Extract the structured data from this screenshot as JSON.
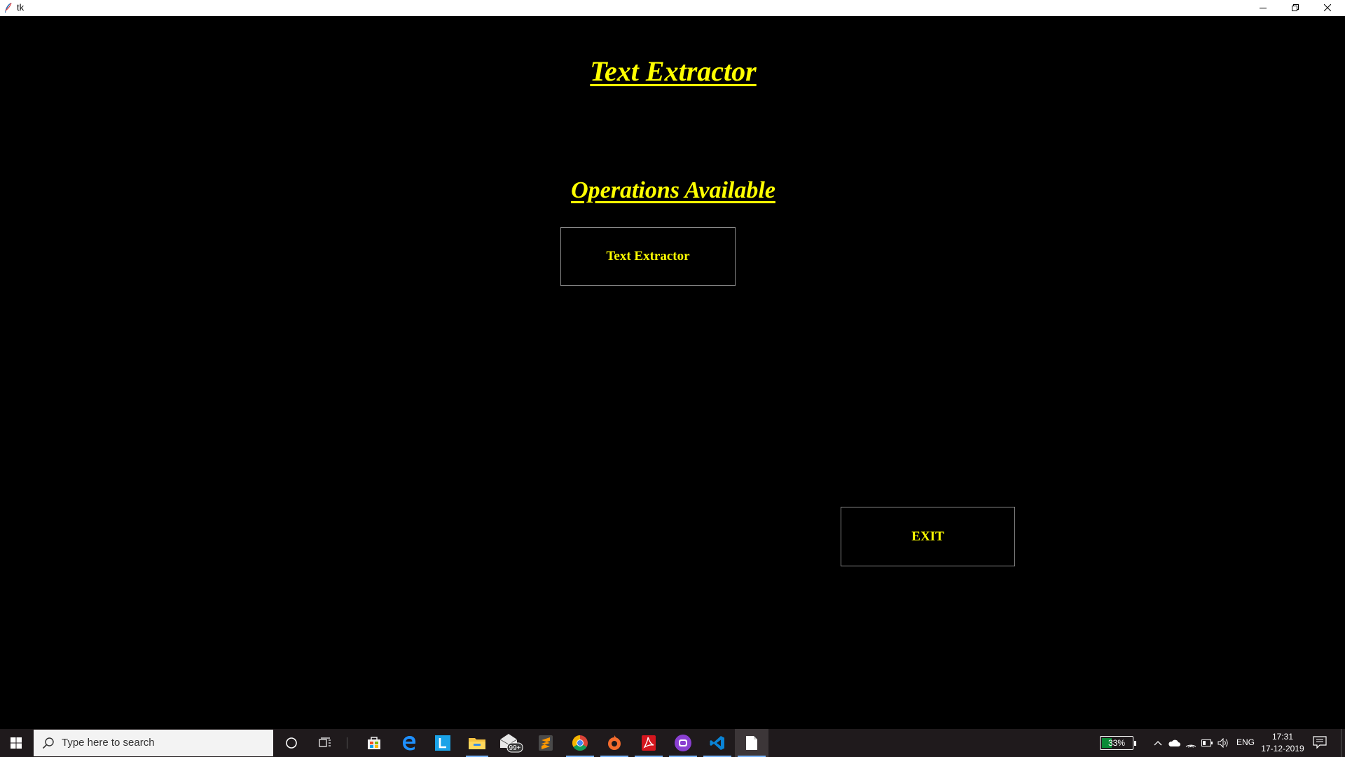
{
  "window": {
    "title": "tk"
  },
  "app": {
    "main_title": "Text Extractor",
    "section_title": "Operations Available",
    "extract_button_label": "Text Extractor",
    "exit_button_label": "EXIT",
    "text_color": "#ffff00",
    "background_color": "#000000"
  },
  "taskbar": {
    "search_placeholder": "Type here to search",
    "mail_badge": "99+",
    "apps": [
      "store-icon",
      "edge-icon",
      "l-app-icon",
      "file-explorer-icon",
      "mail-icon",
      "sublime-text-icon",
      "chrome-icon",
      "origin-icon",
      "acrobat-icon",
      "purple-app-icon",
      "vscode-icon",
      "document-icon"
    ],
    "battery_percent": "33%",
    "battery_level": 0.33,
    "language": "ENG",
    "time": "17:31",
    "date": "17-12-2019"
  }
}
